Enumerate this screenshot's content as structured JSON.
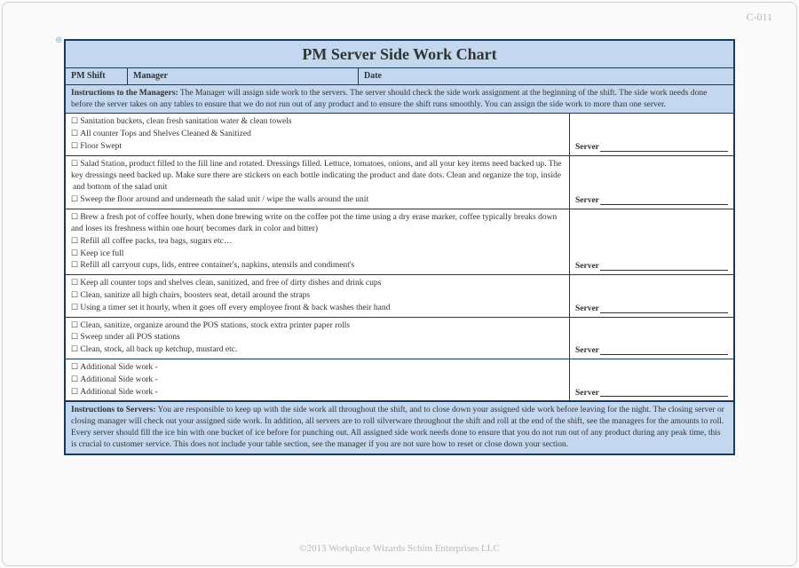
{
  "docCode": "C-011",
  "title": "PM Server Side Work Chart",
  "header": {
    "shiftLabel": "PM Shift",
    "managerLabel": "Manager",
    "dateLabel": "Date"
  },
  "managerInstrLabel": "Instructions to the Managers:",
  "managerInstrText": "The Manager will assign side work to the servers. The server should check the side work assignment at the beginning of the shift. The side work needs done before the server takes on any tables to ensure that we do not run out of any product and to ensure the shift runs smoothly.  You can assign the side work to more than one server.",
  "serverLabel": "Server",
  "sections": [
    {
      "tasks": [
        "Sanitation buckets, clean fresh sanitation water & clean towels",
        "All counter Tops and Shelves Cleaned & Sanitized",
        "Floor Swept"
      ]
    },
    {
      "tasks": [
        "Salad Station, product filled to the fill line and rotated. Dressings filled. Lettuce, tomatoes, onions, and all your key items need backed up. The key dressings need backed up. Make sure there are stickers on each bottle indicating the product and date dots. Clean and organize the top, inside"
      ],
      "plain": " and bottom of the salad unit",
      "tasks2": [
        "Sweep the floor around and underneath the salad unit / wipe the walls around the unit"
      ]
    },
    {
      "tasks": [
        "Brew a fresh pot of coffee hourly, when done brewing write on the coffee pot the time using a dry erase marker, coffee typically breaks down and loses its freshness within one hour( becomes dark in color and bitter)",
        "Refill all coffee packs, tea bags, sugars etc…",
        "Keep ice full",
        "Refill all carryout cups, lids, entree container's, napkins, utensils and condiment's"
      ]
    },
    {
      "tasks": [
        "Keep all counter tops and shelves clean, sanitized, and free of dirty dishes and drink cups",
        "Clean, sanitize all high chairs, boosters seat, detail around the straps",
        "Using a timer set it hourly, when it goes off every employee front & back washes their hand"
      ]
    },
    {
      "tasks": [
        "Clean, sanitize, organize around the POS stations, stock extra printer paper rolls",
        "Sweep under all POS stations",
        "Clean, stock, all back up ketchup, mustard etc."
      ]
    },
    {
      "tasks": [
        "Additional Side work -",
        "Additional Side work -",
        "Additional Side work -"
      ]
    }
  ],
  "serverInstrLabel": "Instructions to Servers:",
  "serverInstrText": "You are responsible to keep up with the side work all throughout the shift, and to close down your assigned side work before leaving for the night. The closing server or closing manager will check out your assigned side work. In addition, all servers are to roll silverware throughout the shift and roll at the end of the shift, see the managers for the amounts to roll. Every server should fill the ice bin with one bucket of ice before for punching out. All assigned side work needs done to ensure that you do not run out of any product during any peak time, this is crucial to customer service. This does not include your table section, see the manager if you are not sure how to reset or close down your section.",
  "footer": "©2013 Workplace Wizards Schim Enterprises LLC"
}
